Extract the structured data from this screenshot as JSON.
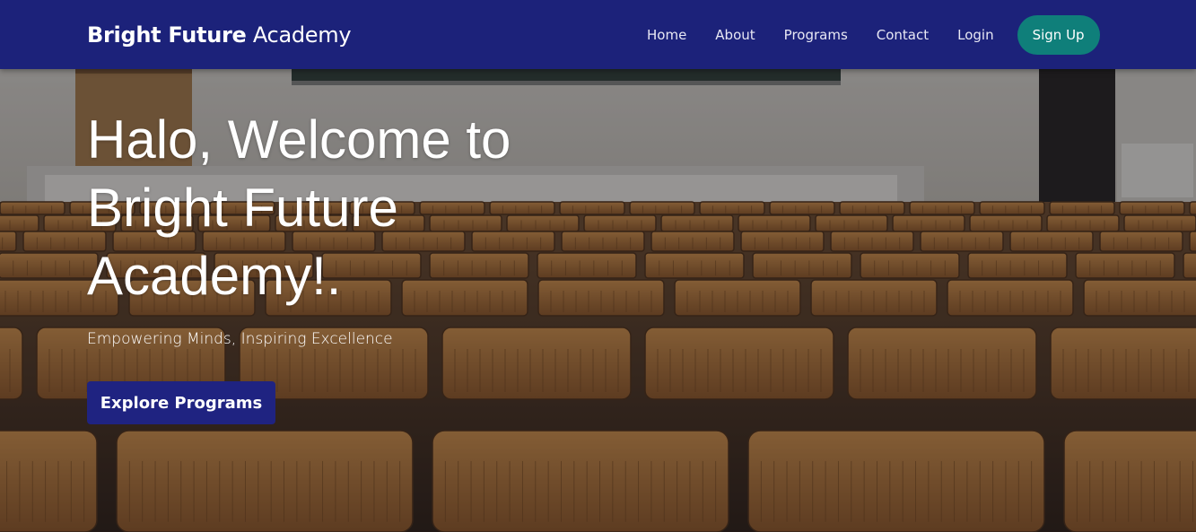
{
  "brand": {
    "name_bold": "Bright Future",
    "name_light": "Academy"
  },
  "nav": {
    "items": [
      {
        "label": "Home"
      },
      {
        "label": "About"
      },
      {
        "label": "Programs"
      },
      {
        "label": "Contact"
      },
      {
        "label": "Login"
      }
    ],
    "signup_label": "Sign Up"
  },
  "hero": {
    "title_lines": [
      "Halo, Welcome to",
      "Bright Future",
      "Academy!."
    ],
    "subtitle": "Empowering Minds, Inspiring Excellence",
    "cta_label": "Explore Programs"
  },
  "colors": {
    "navbar": "#1c227a",
    "signup": "#0f7f7a",
    "cta": "#1f2381",
    "text": "#ffffff"
  }
}
